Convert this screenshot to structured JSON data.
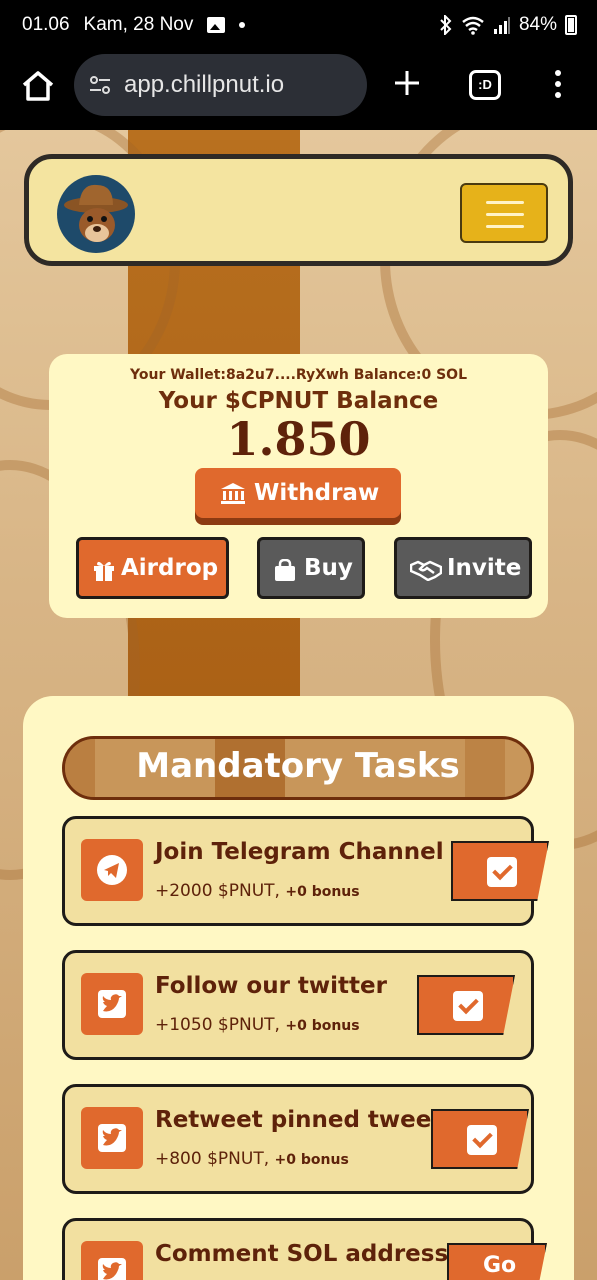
{
  "status_bar": {
    "time": "01.06",
    "date": "Kam, 28 Nov",
    "battery": "84%"
  },
  "browser": {
    "url": "app.chillpnut.io",
    "tab_label": ":D"
  },
  "wallet": {
    "wallet_line": "Your Wallet:8a2u7....RyXwh Balance:0 SOL",
    "balance_label": "Your $CPNUT Balance",
    "balance_amount": "1.850",
    "withdraw_label": "Withdraw",
    "airdrop_label": "Airdrop",
    "buy_label": "Buy",
    "invite_label": "Invite"
  },
  "tasks": {
    "title": "Mandatory Tasks",
    "items": [
      {
        "name": "Join Telegram Channel",
        "reward": "+2000 $PNUT,",
        "bonus": "+0 bonus",
        "icon": "telegram-icon",
        "status": "done"
      },
      {
        "name": "Follow our twitter",
        "reward": "+1050 $PNUT,",
        "bonus": "+0 bonus",
        "icon": "twitter-icon",
        "status": "done"
      },
      {
        "name": "Retweet pinned tweet",
        "reward": "+800 $PNUT,",
        "bonus": "+0 bonus",
        "icon": "twitter-icon",
        "status": "done"
      },
      {
        "name": "Comment SOL address",
        "action": "Go",
        "icon": "twitter-icon",
        "status": "pending"
      }
    ]
  },
  "colors": {
    "accent": "#e0692d",
    "card": "#fff8c4",
    "text_brown": "#5e220a",
    "gold": "#e6b21a"
  }
}
